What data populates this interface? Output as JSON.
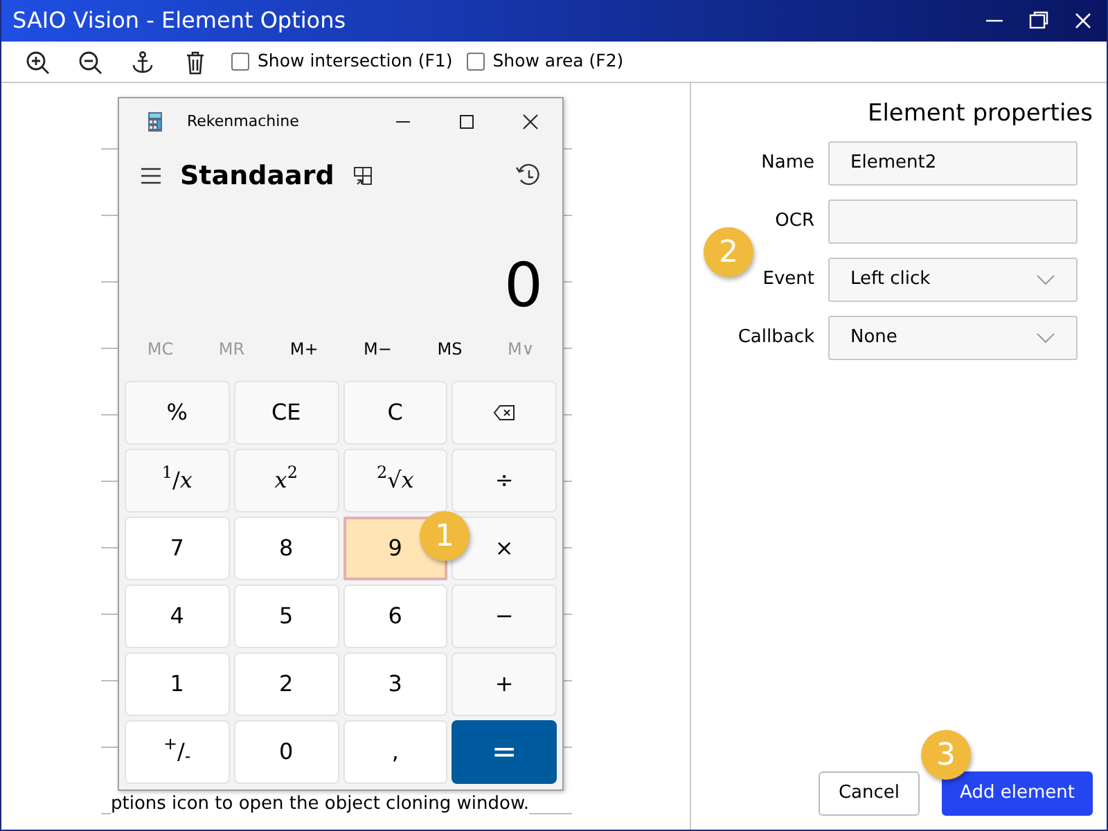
{
  "window": {
    "title": "SAIO Vision - Element Options"
  },
  "toolbar": {
    "tools": [
      {
        "kind": "zoom-in"
      },
      {
        "kind": "zoom-out"
      },
      {
        "kind": "anchor"
      },
      {
        "kind": "delete"
      }
    ],
    "checkboxes": [
      {
        "label": "Show intersection (F1)",
        "checked": false
      },
      {
        "label": "Show area (F2)",
        "checked": false
      }
    ]
  },
  "screenshot": {
    "calculator": {
      "title": "Rekenmachine",
      "mode": "Standaard",
      "display": "0",
      "memory": [
        {
          "label": "MC",
          "disabled": true
        },
        {
          "label": "MR",
          "disabled": true
        },
        {
          "label": "M+",
          "disabled": false
        },
        {
          "label": "M−",
          "disabled": false
        },
        {
          "label": "MS",
          "disabled": false
        },
        {
          "label": "M∨",
          "disabled": true
        }
      ],
      "keys": [
        {
          "kind": "fn",
          "label": "%",
          "selected": false
        },
        {
          "kind": "fn",
          "label": "CE",
          "selected": false
        },
        {
          "kind": "fn",
          "label": "C",
          "selected": false
        },
        {
          "kind": "backspace",
          "selected": false
        },
        {
          "kind": "fn",
          "label": "$^{1}$/*x*",
          "selected": false
        },
        {
          "kind": "fn",
          "label": "*x*$^{2}$",
          "selected": false
        },
        {
          "kind": "fn",
          "label": "$^{2}$√*x*",
          "selected": false
        },
        {
          "kind": "fn",
          "label": "÷",
          "selected": false
        },
        {
          "kind": "num",
          "label": "7",
          "selected": false
        },
        {
          "kind": "num",
          "label": "8",
          "selected": false
        },
        {
          "kind": "num",
          "label": "9",
          "selected": true
        },
        {
          "kind": "fn",
          "label": "×",
          "selected": false
        },
        {
          "kind": "num",
          "label": "4",
          "selected": false
        },
        {
          "kind": "num",
          "label": "5",
          "selected": false
        },
        {
          "kind": "num",
          "label": "6",
          "selected": false
        },
        {
          "kind": "fn",
          "label": "−",
          "selected": false
        },
        {
          "kind": "num",
          "label": "1",
          "selected": false
        },
        {
          "kind": "num",
          "label": "2",
          "selected": false
        },
        {
          "kind": "num",
          "label": "3",
          "selected": false
        },
        {
          "kind": "fn",
          "label": "+",
          "selected": false
        },
        {
          "kind": "num",
          "label": "$^{+}$/$_{-}$",
          "selected": false
        },
        {
          "kind": "num",
          "label": "0",
          "selected": false
        },
        {
          "kind": "num",
          "label": ",",
          "selected": false
        },
        {
          "kind": "equals",
          "label": "=",
          "selected": false
        }
      ]
    },
    "doc_text": "ptions icon to open the object cloning window."
  },
  "properties": {
    "heading": "Element properties",
    "fields": [
      {
        "label": "Name",
        "kind": "text",
        "value": "Element2"
      },
      {
        "label": "OCR",
        "kind": "text"
      },
      {
        "label": "Event",
        "kind": "select",
        "value": "Left click"
      },
      {
        "label": "Callback",
        "kind": "select",
        "value": "None"
      }
    ],
    "buttons": [
      {
        "label": "Cancel",
        "kind": "secondary"
      },
      {
        "label": "Add element",
        "kind": "primary"
      }
    ]
  },
  "callouts": [
    {
      "label": "1"
    },
    {
      "label": "2"
    },
    {
      "label": "3"
    }
  ]
}
